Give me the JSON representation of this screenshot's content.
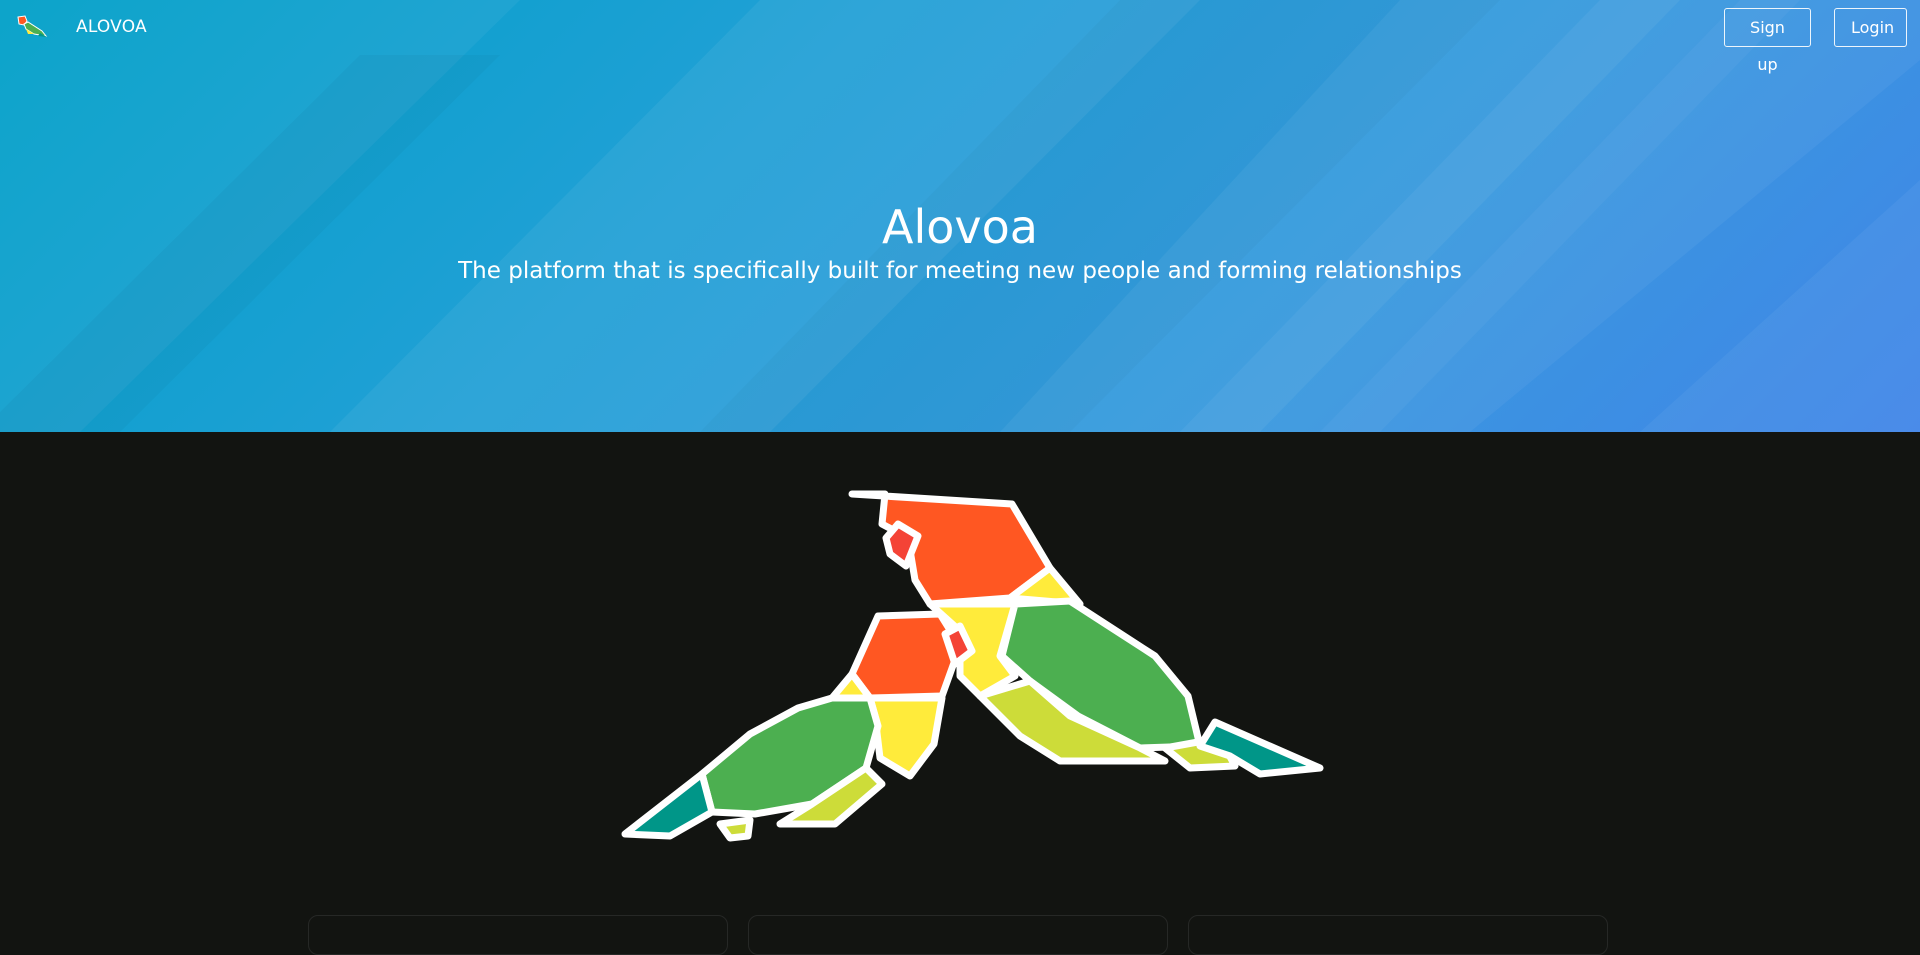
{
  "navbar": {
    "brand": "ALOVOA",
    "logo_icon": "parrot-logo-icon",
    "signup_label": "Sign up",
    "login_label": "Login"
  },
  "hero": {
    "title": "Alovoa",
    "subtitle": "The platform that is specifically built for meeting new people and forming relationships"
  },
  "illustration": {
    "icon": "two-parrots-illustration"
  },
  "colors": {
    "hero_gradient_start": "#00a0c8",
    "hero_gradient_end": "#4185e8",
    "page_background": "#121411",
    "parrot_head": "#ff5722",
    "parrot_beak": "#f44336",
    "parrot_neck": "#ffeb3b",
    "parrot_body": "#4caf50",
    "parrot_belly": "#cddc39",
    "parrot_tail": "#009688"
  }
}
